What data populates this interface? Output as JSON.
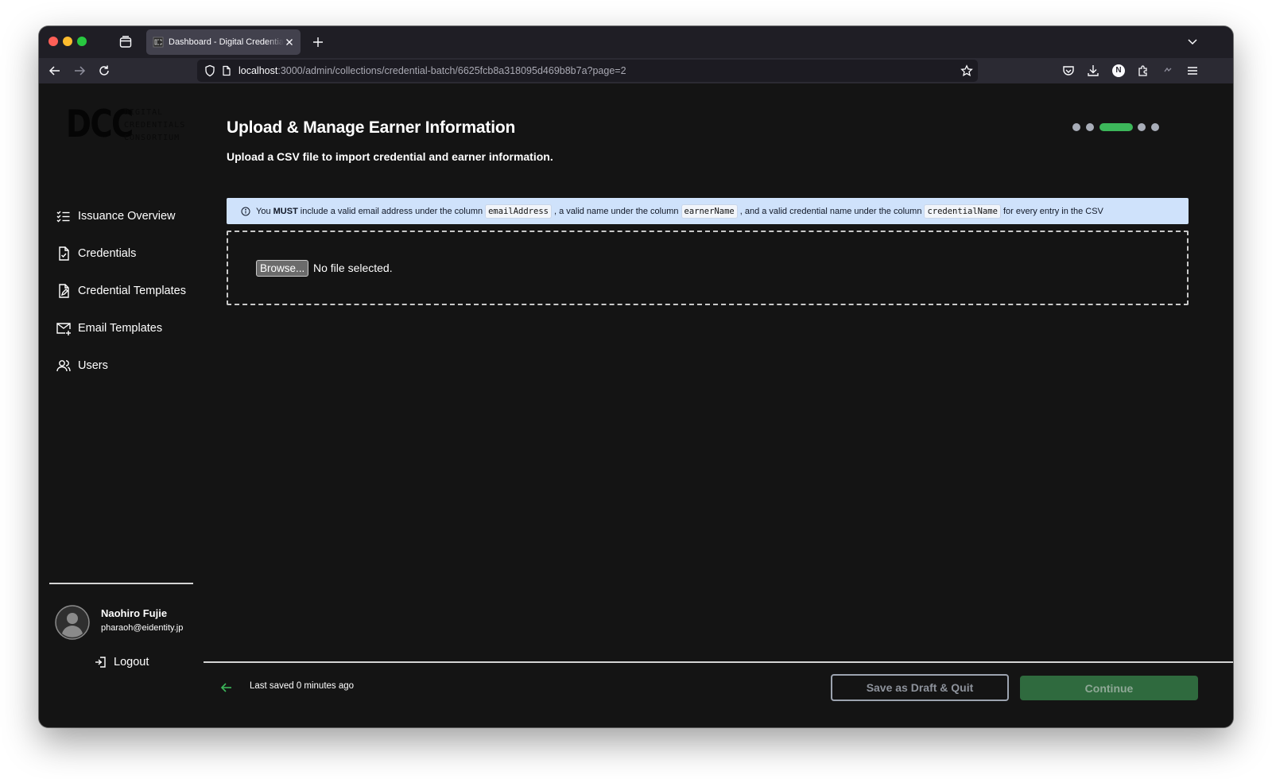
{
  "browser": {
    "tab_title": "Dashboard - Digital Credentials Consortium",
    "url_host": "localhost",
    "url_path": ":3000/admin/collections/credential-batch/6625fcb8a318095d469b8b7a?page=2",
    "profile_initial": "N"
  },
  "sidebar": {
    "logo": {
      "mark": "DCC",
      "line1": "DIGITAL",
      "line2": "CREDENTIALS",
      "line3": "CONSORTIUM"
    },
    "items": [
      {
        "label": "Issuance Overview",
        "icon": "list-check-icon"
      },
      {
        "label": "Credentials",
        "icon": "document-check-icon"
      },
      {
        "label": "Credential Templates",
        "icon": "document-edit-icon"
      },
      {
        "label": "Email Templates",
        "icon": "mail-plus-icon"
      },
      {
        "label": "Users",
        "icon": "users-icon"
      }
    ],
    "user": {
      "name": "Naohiro Fujie",
      "email": "pharaoh@eidentity.jp"
    },
    "logout_label": "Logout"
  },
  "main": {
    "title": "Upload & Manage Earner Information",
    "subtitle": "Upload a CSV file to import credential and earner information.",
    "progress": {
      "steps": 5,
      "current": 3
    },
    "alert": {
      "prefix": "You",
      "emphasis": "MUST",
      "text1": "include a valid email address under the column",
      "code1": "emailAddress",
      "text2": ", a valid name under the column",
      "code2": "earnerName",
      "text3": ", and a valid credential name under the column",
      "code3": "credentialName",
      "text4": "for every entry in the CSV"
    },
    "file_input": {
      "button_label": "Browse...",
      "status": "No file selected."
    }
  },
  "footer": {
    "last_saved": "Last saved 0 minutes ago",
    "draft_label": "Save as Draft & Quit",
    "continue_label": "Continue"
  },
  "colors": {
    "accent_green": "#3cb75a",
    "continue_bg": "#2f6a3e",
    "alert_bg": "#cfe2fb"
  }
}
